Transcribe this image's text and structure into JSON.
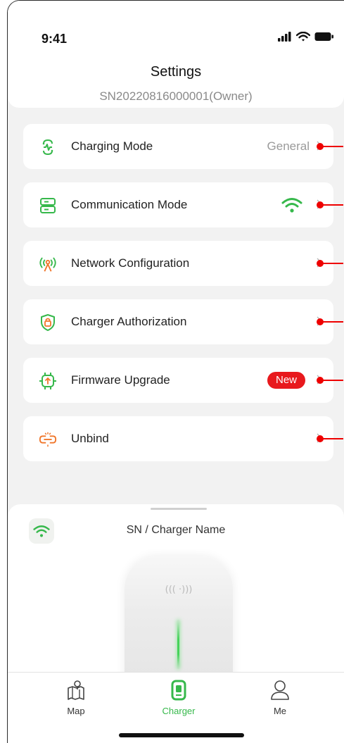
{
  "status_bar": {
    "time": "9:41"
  },
  "header": {
    "title": "Settings",
    "subtitle": "SN20220816000001(Owner)"
  },
  "menu": [
    {
      "label": "Charging Mode",
      "value": "General",
      "icon": "charging-mode-icon"
    },
    {
      "label": "Communication Mode",
      "value": "",
      "icon": "communication-mode-icon",
      "status_icon": "wifi-icon"
    },
    {
      "label": "Network Configuration",
      "value": "",
      "icon": "network-antenna-icon"
    },
    {
      "label": "Charger Authorization",
      "value": "",
      "icon": "shield-lock-icon"
    },
    {
      "label": "Firmware Upgrade",
      "value": "",
      "badge": "New",
      "icon": "firmware-chip-icon"
    },
    {
      "label": "Unbind",
      "value": "",
      "icon": "unlink-icon"
    }
  ],
  "sheet": {
    "title": "SN / Charger Name",
    "nfc_symbol": "((( ·)))"
  },
  "tabs": [
    {
      "label": "Map",
      "icon": "map-icon",
      "active": false
    },
    {
      "label": "Charger",
      "icon": "charger-icon",
      "active": true
    },
    {
      "label": "Me",
      "icon": "person-icon",
      "active": false
    }
  ],
  "colors": {
    "accent_green": "#36b84b",
    "annotation_red": "#e00000",
    "badge_red": "#e8191d",
    "orange_icon": "#f0762a"
  }
}
